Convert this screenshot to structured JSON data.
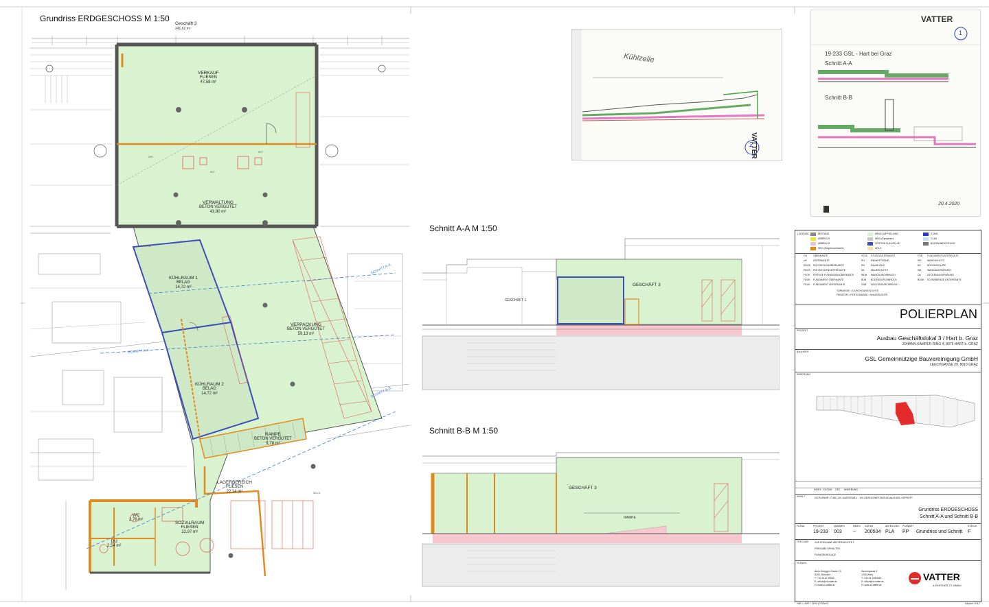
{
  "plan": {
    "title": "Grundriss ERDGESCHOSS  M 1:50",
    "top_label": "Geschäft 3",
    "top_area": "241,62 m²",
    "rooms": {
      "verkauf": {
        "name": "VERKAUF",
        "floor": "FLIESEN",
        "area": "47,58 m²"
      },
      "verwaltung": {
        "name": "VERWALTUNG",
        "floor": "BETON VERGÜTET",
        "area": "43,90 m²"
      },
      "kuehlraum1": {
        "name": "KÜHLRAUM 1",
        "floor": "BELAG",
        "area": "14,72 m²"
      },
      "kuehlraum2": {
        "name": "KÜHLRAUM 2",
        "floor": "BELAG",
        "area": "14,72 m²"
      },
      "verpackung": {
        "name": "VERPACKUNG",
        "floor": "BETON VERGÜTET",
        "area": "59,13 m²"
      },
      "rampe": {
        "name": "RAMPE",
        "floor": "BETON VERGÜTET",
        "area": "5,78 m²"
      },
      "lagerbereich": {
        "name": "LAGERBEREICH",
        "floor": "FLIESEN",
        "area": "22,14 m²"
      },
      "sozialraum": {
        "name": "SOZIALRAUM",
        "floor": "FLIESEN",
        "area": "22,97 m²"
      },
      "wc": {
        "name": "WC",
        "area": "2,76 m²"
      },
      "du": {
        "name": "DU",
        "area": "2,54 m²"
      }
    },
    "schnitt_aa": "SCHNITT A-A",
    "schnitt_bb": "SCHNITT B-B"
  },
  "sections": {
    "aa_title": "Schnitt A-A   M 1:50",
    "bb_title": "Schnitt B-B   M 1:50",
    "aa_room": "GESCHÄFT 3",
    "aa_left": "GESCHÄFT 1",
    "bb_room": "GESCHÄFT 3",
    "bb_rampe": "RAMPE"
  },
  "sketches": {
    "sketch1_label": "Kühlzelle",
    "sketch1_num": "2",
    "sketch2_num": "1",
    "sketch2_title": "19-233  GSL - Hart bei Graz",
    "sketch2_a": "Schnitt A-A",
    "sketch2_b": "Schnitt B-B",
    "sketch2_date": "20.4.2020",
    "vatter": "VATTER"
  },
  "legend": {
    "header": "LEGENDE",
    "items": [
      [
        "BESTAND",
        "NEUE AUFFÜLLUNG",
        "STAHL"
      ],
      [
        "ABBRUCH",
        "NEU (Gipskarton)",
        "GLAS"
      ],
      [
        "ABBRUCH",
        "FERTIGE KÜHLZELLE",
        "BODENABDICHTUNG"
      ],
      [
        "NEU (Ziegelmauerwerk)",
        "HOLZ",
        ""
      ]
    ],
    "abbr": [
      [
        "OK",
        "OBERKANTE",
        "STUK",
        "STURZUNTERKANTE",
        "FOB",
        "FUNDAMENTUNTERKANTE"
      ],
      [
        "UK",
        "UNTERKANTE",
        "PH",
        "PARAPETHÖHE",
        "WS",
        "WANDSCHLITZ"
      ],
      [
        "RDOK",
        "ROH DECKENOBERKANTE",
        "RH",
        "RAUMHÖHE",
        "BS",
        "BODENSCHLITZ"
      ],
      [
        "RDUK",
        "ROH DECKENUNTERKANTE",
        "ML",
        "MAUERLICHTE",
        "WA",
        "WANDAUSSPARUNG"
      ],
      [
        "FFOK",
        "FERTIGE FUSSBODENOBERKANTE",
        "WDB",
        "WANDDURCHBRUCH",
        "DA",
        "DECKENAUSSPARUNG"
      ],
      [
        "FDOK",
        "FUNDAMENT OBERKANTE",
        "BDB",
        "BODENDURCHBRUCH",
        "BDUK",
        "SCHWEBENDE UNTERKANTE"
      ],
      [
        "FDUK",
        "FUNDAMENT UNTERKANTE",
        "DDB",
        "DECKENDURCHBRUCH",
        "",
        ""
      ]
    ],
    "door_row": "TÜRMASSE = DURCHGANGSLICHTE",
    "window_row": "FENSTER = FERTIGMASSE = MAUERLICHTE"
  },
  "titleblock": {
    "poliertitle": "POLIERPLAN",
    "projekt_label": "PROJEKT",
    "projekt": "Ausbau Geschäftslokal 3 / Hart b. Graz",
    "projekt_addr": "JOHANN KAMPER RING 4, 8075 HART b. GRAZ",
    "bauherr_label": "BAUHERR",
    "bauherr": "GSL Gemeinnützige Bauvereinigung GmbH",
    "bauherr_addr": "LEECHGASSE 29, 8010 GRAZ",
    "aenderung_label": "ÄNDERUNG",
    "aenderung_cols": [
      "INDEX",
      "DATUM",
      "GEZ.",
      "ÄNDERUNG"
    ],
    "inhalt_label": "INHALT",
    "inhalt_meta": "GZ-PLANNR   17.082_001   MASSSTAB   1 : 100   GEZEICHNET/DATUM   cbp/1150X   GEPRÜFT",
    "inhalt1": "Grundriss ERDGESCHOSS",
    "inhalt2": "Schnitt A-A und Schnitt B-B",
    "plana_label": "PLANA",
    "plan_cols": [
      "PROJEKT",
      "NUMMER",
      "INDEX",
      "DATUM",
      "ABTEILUNG",
      "PLANART",
      "",
      "STATUS"
    ],
    "plan_vals": [
      "19-233",
      "003",
      "--",
      "200504",
      "PLA",
      "PP",
      "Grundriss und Schnitt",
      "F"
    ],
    "freigabe_label": "FREIGABE",
    "freigabe_rows": [
      "ZUR FREIGABE WEITERGELEITET",
      "FREIGABE ERHALTEN",
      "PLANGRUNDLAGE"
    ],
    "planer_label": "PLANER",
    "planer_addr1": "Alois-Griegger-Gasse 13\n8200 Gleisdorf\nT: +43 3112 25630\nE: office@zt-vatter.at\nH: www.zt-vatter.at",
    "planer_addr2": "Zaunergasse 4\n1030 Wien\nT: +43 01 2350060\nE: office@zt-vatter.at\nH: www.zt-vatter.at",
    "logo": "VATTER",
    "logo_sub": "& PARTNER ZT-GMBH",
    "footer_left": "H/B = 450 / 1150 (0.52m²)",
    "footer_right": "Allplan 2017"
  }
}
